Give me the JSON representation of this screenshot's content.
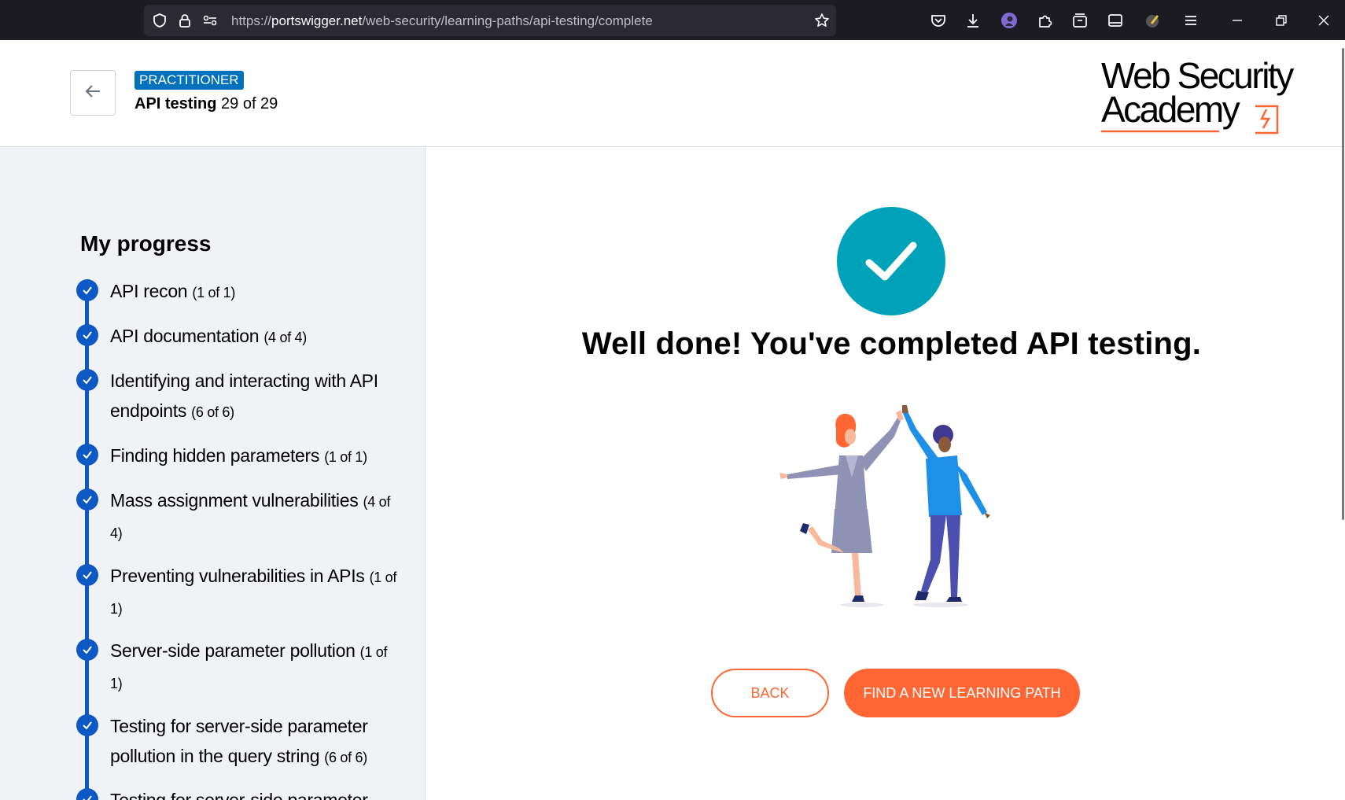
{
  "browser": {
    "url_prefix": "https://",
    "url_host": "portswigger.net",
    "url_path": "/web-security/learning-paths/api-testing/complete"
  },
  "header": {
    "level_badge": "PRACTITIONER",
    "path_title": "API testing",
    "path_progress": "29 of 29",
    "logo_line1": "Web Security",
    "logo_line2": "Academy"
  },
  "sidebar": {
    "title": "My progress",
    "items": [
      {
        "label": "API recon",
        "count": "(1 of 1)"
      },
      {
        "label": "API documentation",
        "count": "(4 of 4)"
      },
      {
        "label": "Identifying and interacting with API endpoints",
        "count": "(6 of 6)"
      },
      {
        "label": "Finding hidden parameters",
        "count": "(1 of 1)"
      },
      {
        "label": "Mass assignment vulnerabilities",
        "count": "(4 of 4)"
      },
      {
        "label": "Preventing vulnerabilities in APIs",
        "count": "(1 of 1)"
      },
      {
        "label": "Server-side parameter pollution",
        "count": "(1 of 1)"
      },
      {
        "label": "Testing for server-side parameter pollution in the query string",
        "count": "(6 of 6)"
      },
      {
        "label": "Testing for server-side parameter",
        "count": ""
      }
    ]
  },
  "main": {
    "headline": "Well done! You've completed API testing.",
    "back_label": "BACK",
    "find_label": "FIND A NEW LEARNING PATH"
  },
  "colors": {
    "accent_orange": "#ff6633",
    "check_teal": "#00a2b9",
    "progress_blue": "#0c58c4",
    "badge_blue": "#0071bc"
  }
}
